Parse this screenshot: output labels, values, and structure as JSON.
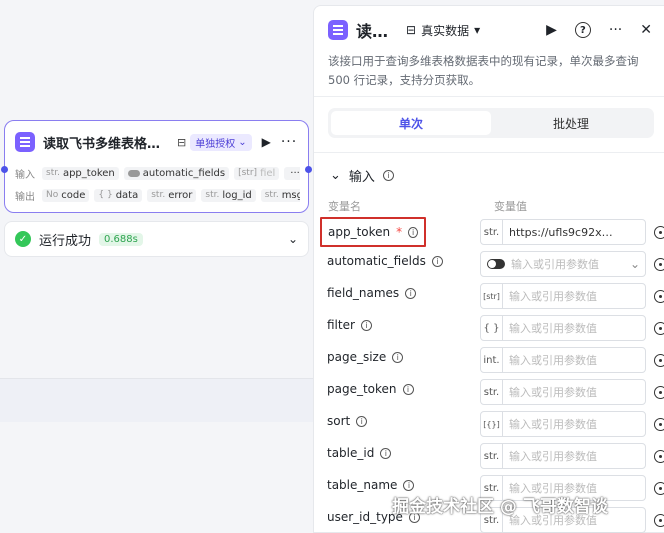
{
  "node": {
    "title": "读取飞书多维表格…",
    "auth_badge": "单独授权",
    "input_label": "输入",
    "output_label": "输出",
    "inputs": [
      {
        "type": "str.",
        "name": "app_token"
      },
      {
        "type": "toggle",
        "name": "automatic_fields"
      },
      {
        "type": "[str]",
        "name": "fiel"
      },
      {
        "type": "",
        "name": "···"
      }
    ],
    "outputs": [
      {
        "type": "No",
        "name": "code"
      },
      {
        "type": "{ }",
        "name": "data"
      },
      {
        "type": "str.",
        "name": "error"
      },
      {
        "type": "str.",
        "name": "log_id"
      },
      {
        "type": "str.",
        "name": "msg"
      }
    ]
  },
  "run_status": {
    "text": "运行成功",
    "time": "0.688s"
  },
  "panel": {
    "title": "读…",
    "data_source": "真实数据",
    "description": "该接口用于查询多维表格数据表中的现有记录，单次最多查询 500 行记录，支持分页获取。",
    "tabs": [
      "单次",
      "批处理"
    ],
    "active_tab": 0,
    "section_title": "输入",
    "col_name": "变量名",
    "col_value": "变量值",
    "params": [
      {
        "name": "app_token",
        "required": true,
        "type": "str.",
        "value": "https://ufls9c92x…",
        "placeholder": ""
      },
      {
        "name": "automatic_fields",
        "required": false,
        "type": "toggle",
        "value": "",
        "placeholder": "输入或引用参数值"
      },
      {
        "name": "field_names",
        "required": false,
        "type": "[str]",
        "value": "",
        "placeholder": "输入或引用参数值"
      },
      {
        "name": "filter",
        "required": false,
        "type": "{ }",
        "value": "",
        "placeholder": "输入或引用参数值"
      },
      {
        "name": "page_size",
        "required": false,
        "type": "int.",
        "value": "",
        "placeholder": "输入或引用参数值"
      },
      {
        "name": "page_token",
        "required": false,
        "type": "str.",
        "value": "",
        "placeholder": "输入或引用参数值"
      },
      {
        "name": "sort",
        "required": false,
        "type": "[{}]",
        "value": "",
        "placeholder": "输入或引用参数值"
      },
      {
        "name": "table_id",
        "required": false,
        "type": "str.",
        "value": "",
        "placeholder": "输入或引用参数值"
      },
      {
        "name": "table_name",
        "required": false,
        "type": "str.",
        "value": "",
        "placeholder": "输入或引用参数值"
      },
      {
        "name": "user_id_type",
        "required": false,
        "type": "str.",
        "value": "",
        "placeholder": "输入或引用参数值"
      }
    ]
  },
  "watermark": "掘金技术社区 @ 飞哥数智谈",
  "colors": {
    "accent": "#4d53e8",
    "app_icon": "#7b61ff",
    "success": "#34c759",
    "highlight": "#d0302b"
  }
}
